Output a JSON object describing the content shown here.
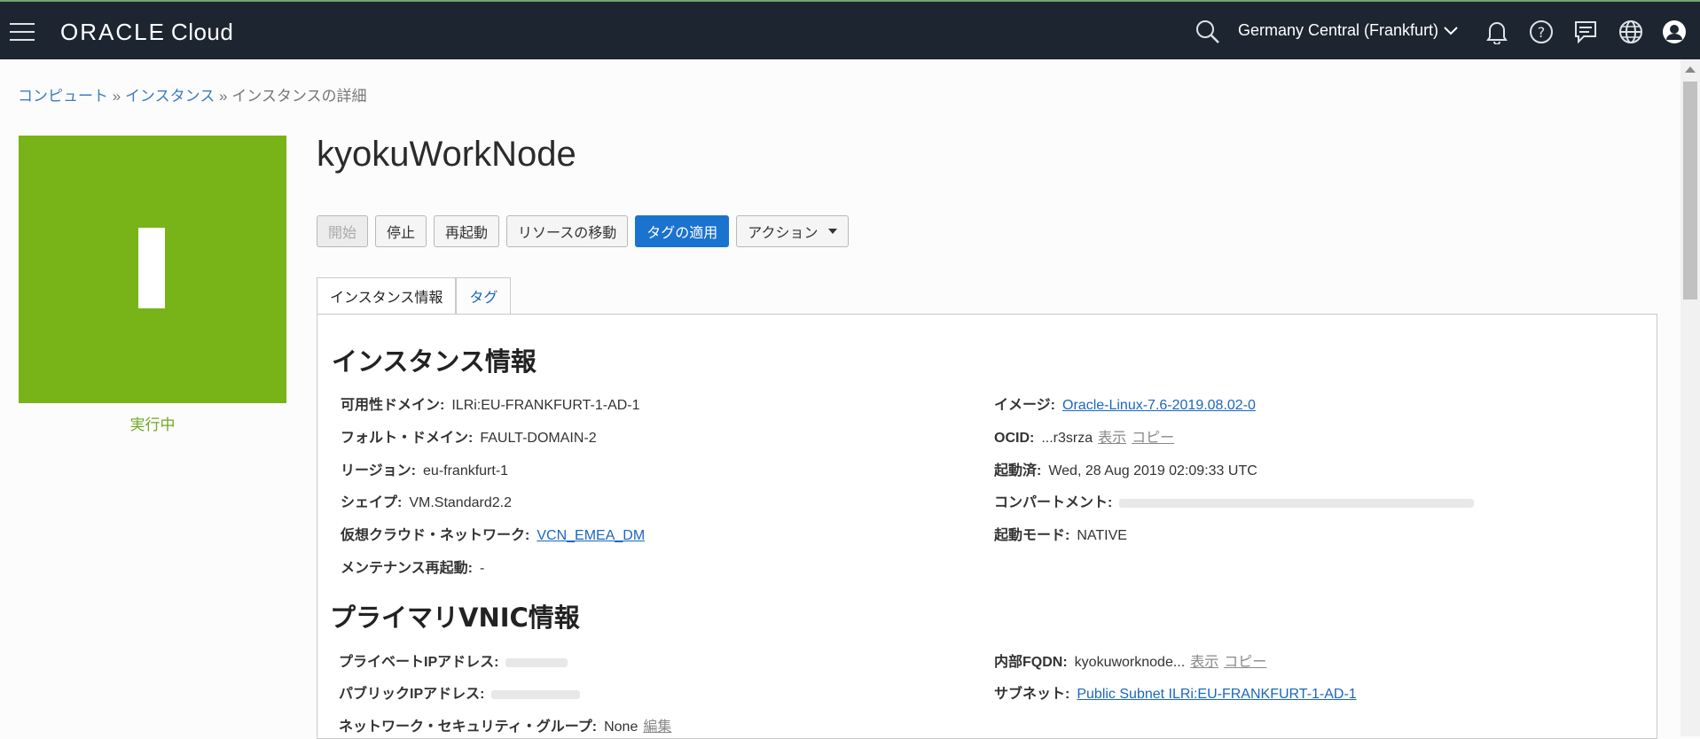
{
  "header": {
    "logo_oracle": "ORACLE",
    "logo_cloud": "Cloud",
    "region": "Germany Central (Frankfurt)"
  },
  "breadcrumb": {
    "items": [
      "コンピュート",
      "インスタンス"
    ],
    "separator": "»",
    "current": "インスタンスの詳細"
  },
  "instance": {
    "name": "kyokuWorkNode",
    "tile_color": "#78b417",
    "status": "実行中"
  },
  "actions": {
    "start": "開始",
    "stop": "停止",
    "reboot": "再起動",
    "move": "リソースの移動",
    "apply_tags": "タグの適用",
    "more": "アクション"
  },
  "tabs": {
    "info": "インスタンス情報",
    "tags": "タグ"
  },
  "info": {
    "heading": "インスタンス情報",
    "availability_domain_label": "可用性ドメイン:",
    "availability_domain": "ILRi:EU-FRANKFURT-1-AD-1",
    "fault_domain_label": "フォルト・ドメイン:",
    "fault_domain": "FAULT-DOMAIN-2",
    "region_label": "リージョン:",
    "region": "eu-frankfurt-1",
    "shape_label": "シェイプ:",
    "shape": "VM.Standard2.2",
    "vcn_label": "仮想クラウド・ネットワーク:",
    "vcn": "VCN_EMEA_DM",
    "maintenance_label": "メンテナンス再起動:",
    "maintenance": "-",
    "image_label": "イメージ:",
    "image": "Oracle-Linux-7.6-2019.08.02-0",
    "ocid_label": "OCID:",
    "ocid": "...r3srza",
    "show": "表示",
    "copy": "コピー",
    "launched_label": "起動済:",
    "launched": "Wed, 28 Aug 2019 02:09:33 UTC",
    "compartment_label": "コンパートメント:",
    "launch_mode_label": "起動モード:",
    "launch_mode": "NATIVE"
  },
  "vnic": {
    "heading": "プライマリVNIC情報",
    "private_ip_label": "プライベートIPアドレス:",
    "public_ip_label": "パブリックIPアドレス:",
    "nsg_label": "ネットワーク・セキュリティ・グループ:",
    "nsg": "None",
    "edit": "編集",
    "fqdn_label": "内部FQDN:",
    "fqdn": "kyokuworknode...",
    "show": "表示",
    "copy": "コピー",
    "subnet_label": "サブネット:",
    "subnet": "Public Subnet ILRi:EU-FRANKFURT-1-AD-1"
  }
}
